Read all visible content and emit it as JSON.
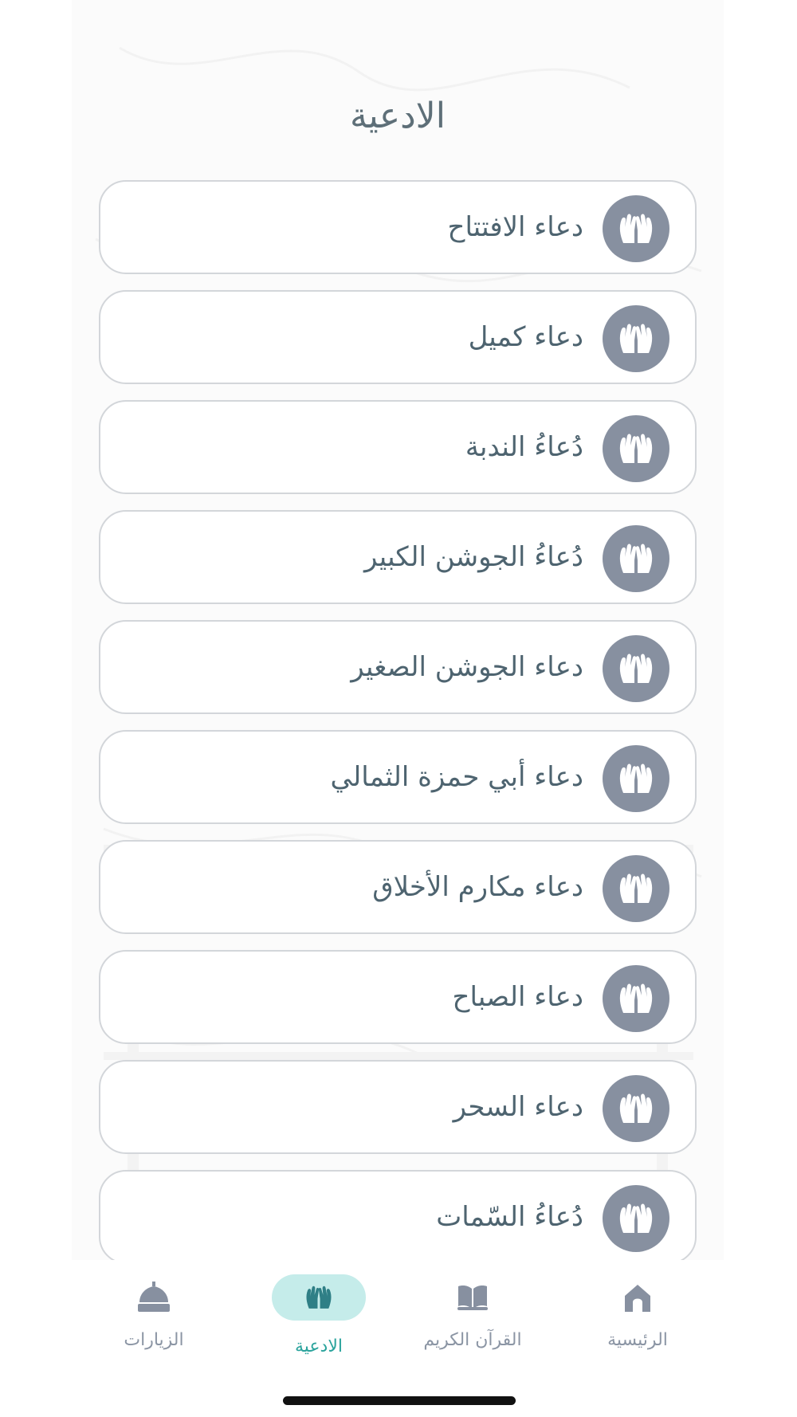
{
  "header": {
    "title": "الادعية"
  },
  "items": [
    {
      "label": "دعاء الافتتاح",
      "icon": "praying-hands-icon"
    },
    {
      "label": "دعاء كميل",
      "icon": "praying-hands-icon"
    },
    {
      "label": "دُعاءُ الندبة",
      "icon": "praying-hands-icon"
    },
    {
      "label": "دُعاءُ الجوشن الكبير",
      "icon": "praying-hands-icon"
    },
    {
      "label": "دعاء الجوشن الصغير",
      "icon": "praying-hands-icon"
    },
    {
      "label": "دعاء أبي حمزة الثمالي",
      "icon": "praying-hands-icon"
    },
    {
      "label": "دعاء مكارم الأخلاق",
      "icon": "praying-hands-icon"
    },
    {
      "label": "دعاء الصباح",
      "icon": "praying-hands-icon"
    },
    {
      "label": "دعاء السحر",
      "icon": "praying-hands-icon"
    },
    {
      "label": "دُعاءُ السّمات",
      "icon": "praying-hands-icon"
    }
  ],
  "bottom_nav": {
    "tabs": [
      {
        "label": "الرئيسية",
        "icon": "home-icon",
        "active": false
      },
      {
        "label": "القرآن الكريم",
        "icon": "quran-book-icon",
        "active": false
      },
      {
        "label": "الادعية",
        "icon": "praying-hands-icon",
        "active": true
      },
      {
        "label": "الزيارات",
        "icon": "shrine-dome-icon",
        "active": false
      }
    ]
  },
  "colors": {
    "accent": "#2aa39c",
    "active_tab_bg": "#c5ecea",
    "icon_circle": "#8790a0",
    "text": "#4e6470"
  }
}
